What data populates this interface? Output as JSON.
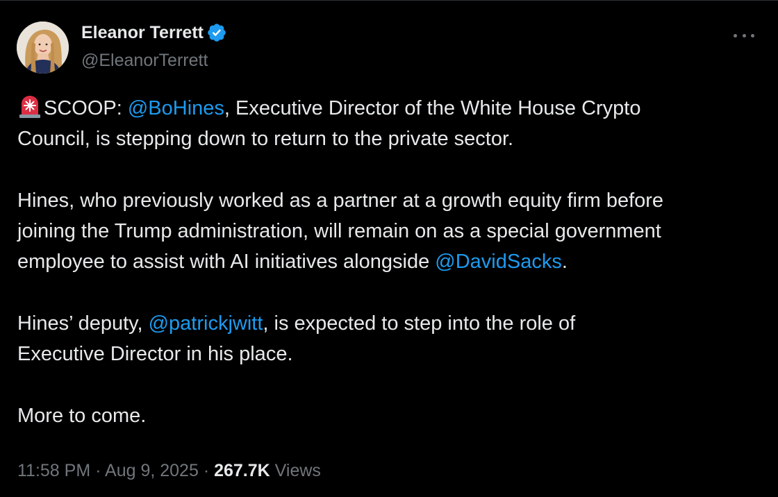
{
  "author": {
    "name": "Eleanor Terrett",
    "handle": "@EleanorTerrett",
    "verified_icon": "verified-badge-icon",
    "avatar_icon": "profile-avatar"
  },
  "menu": {
    "icon": "more-options-icon"
  },
  "tweet": {
    "siren_icon": "siren-emoji-icon",
    "p1_prefix": "SCOOP: ",
    "p1_mention": "@BoHines",
    "p1_text1": ", Executive Director of the White House Crypto",
    "p1_text2": "Council, is stepping down to return to the private sector.",
    "p2_line1": "Hines, who previously worked as a partner at a growth equity firm before",
    "p2_line2": "joining the Trump administration, will remain on as a special government",
    "p2_line3_prefix": "employee to assist with AI initiatives alongside ",
    "p2_mention": "@DavidSacks",
    "p2_suffix": ".",
    "p3_prefix": "Hines’ deputy, ",
    "p3_mention": "@patrickjwitt",
    "p3_text1": ", is expected to step into the role of",
    "p3_text2": "Executive Director in his place.",
    "p4": "More to come."
  },
  "meta": {
    "time": "11:58 PM",
    "separator": "·",
    "date": "Aug 9, 2025",
    "views_count": "267.7K",
    "views_label": "Views"
  },
  "colors": {
    "background": "#000000",
    "text": "#e7e9ea",
    "secondary": "#71767b",
    "link": "#1d9bf0",
    "verified": "#1d9bf0"
  }
}
